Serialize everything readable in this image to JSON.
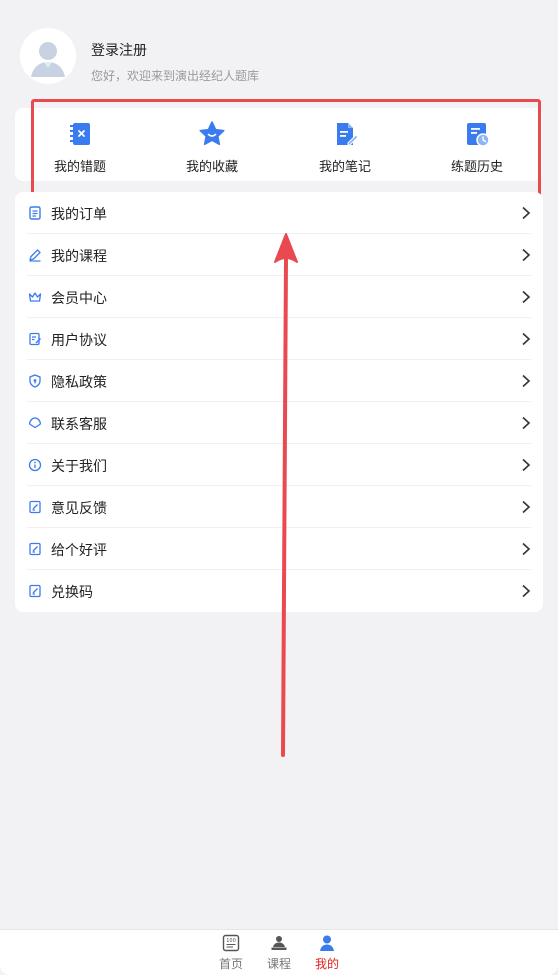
{
  "profile": {
    "title": "登录注册",
    "subtitle": "您好，欢迎来到演出经纪人题库"
  },
  "quick_actions": [
    {
      "label": "我的错题",
      "icon": "wrong-questions-icon"
    },
    {
      "label": "我的收藏",
      "icon": "star-icon"
    },
    {
      "label": "我的笔记",
      "icon": "note-edit-icon"
    },
    {
      "label": "练题历史",
      "icon": "history-clock-icon"
    }
  ],
  "menu": [
    {
      "label": "我的订单",
      "icon": "order-icon"
    },
    {
      "label": "我的课程",
      "icon": "pen-icon"
    },
    {
      "label": "会员中心",
      "icon": "crown-icon"
    },
    {
      "label": "用户协议",
      "icon": "agreement-icon"
    },
    {
      "label": "隐私政策",
      "icon": "shield-icon"
    },
    {
      "label": "联系客服",
      "icon": "customer-service-icon"
    },
    {
      "label": "关于我们",
      "icon": "info-icon"
    },
    {
      "label": "意见反馈",
      "icon": "feedback-icon"
    },
    {
      "label": "给个好评",
      "icon": "review-icon"
    },
    {
      "label": "兑换码",
      "icon": "redeem-icon"
    }
  ],
  "tabbar": [
    {
      "label": "首页",
      "icon": "home-100-icon",
      "active": false
    },
    {
      "label": "课程",
      "icon": "course-icon",
      "active": false
    },
    {
      "label": "我的",
      "icon": "user-icon",
      "active": true
    }
  ],
  "colors": {
    "accent_blue": "#3a7bf0",
    "active_red": "#e02020",
    "annotation_red": "#e84a4f"
  }
}
